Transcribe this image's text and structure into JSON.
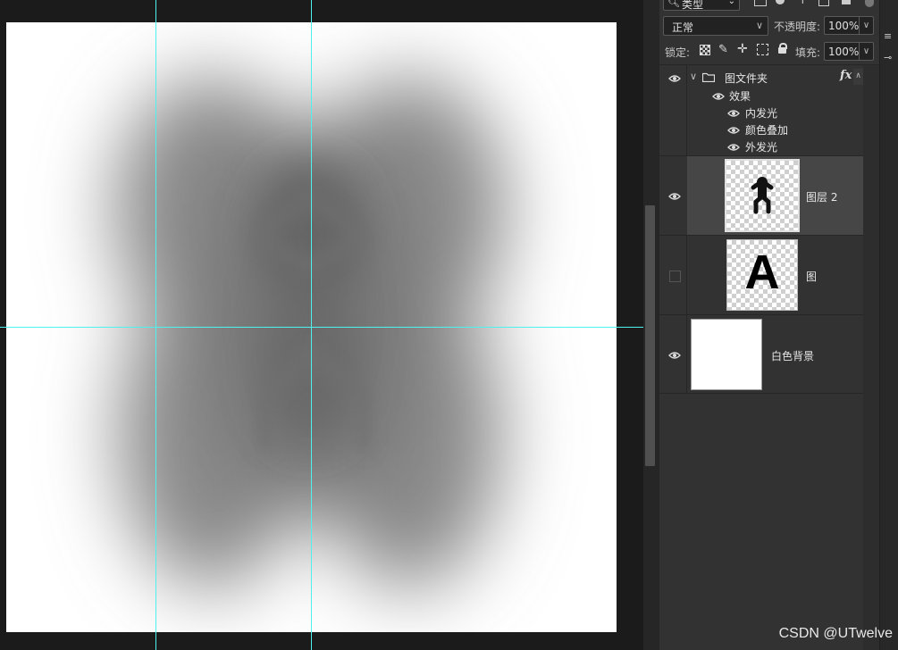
{
  "search": {
    "filter_label": "类型"
  },
  "blend": {
    "mode": "正常",
    "opacity_label": "不透明度:",
    "opacity_value": "100%"
  },
  "lock": {
    "label": "锁定:",
    "fill_label": "填充:",
    "fill_value": "100%"
  },
  "layers": {
    "group": {
      "name": "图文件夹",
      "fx_label": "fx",
      "effects_label": "效果",
      "effects": [
        "内发光",
        "颜色叠加",
        "外发光"
      ]
    },
    "layer2": {
      "name": "图层 2"
    },
    "layer_a": {
      "name": "图",
      "thumb_text": "A"
    },
    "background": {
      "name": "白色背景"
    }
  },
  "watermark": "CSDN @UTwelve",
  "colors": {
    "guide": "#4ff0f0",
    "panel_bg": "#323232",
    "selected_row": "#464646"
  }
}
